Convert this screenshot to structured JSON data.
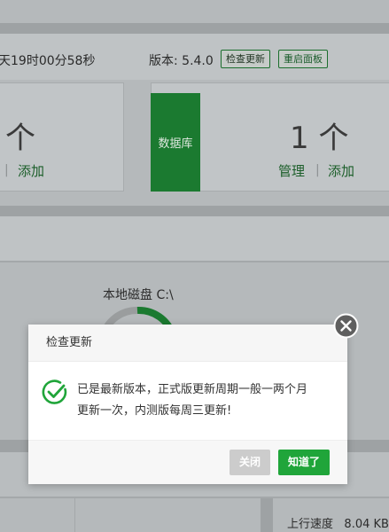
{
  "status": {
    "uptime_text": "天19时00分58秒",
    "version_label": "版本: 5.4.0",
    "check_update_label": "检查更新",
    "restart_panel_label": "重启面板"
  },
  "cards": {
    "left_count": "个",
    "left_add_link": "添加",
    "left_sep": "|",
    "database_label": "数据库",
    "right_count": "1 个",
    "manage_link": "管理",
    "right_sep": "|",
    "right_add_link": "添加"
  },
  "disk": {
    "label": "本地磁盘 C:\\"
  },
  "network": {
    "upload_label": "上行速度",
    "upload_value": "8.04 KB"
  },
  "modal": {
    "title": "检查更新",
    "message_line1": "已是最新版本，正式版更新周期一般一两个月",
    "message_line2": "更新一次，内测版每周三更新!",
    "close_label": "关闭",
    "ok_label": "知道了"
  },
  "colors": {
    "accent": "#20a53a",
    "button_disabled": "#cccccc",
    "modal_background": "#ffffff"
  }
}
